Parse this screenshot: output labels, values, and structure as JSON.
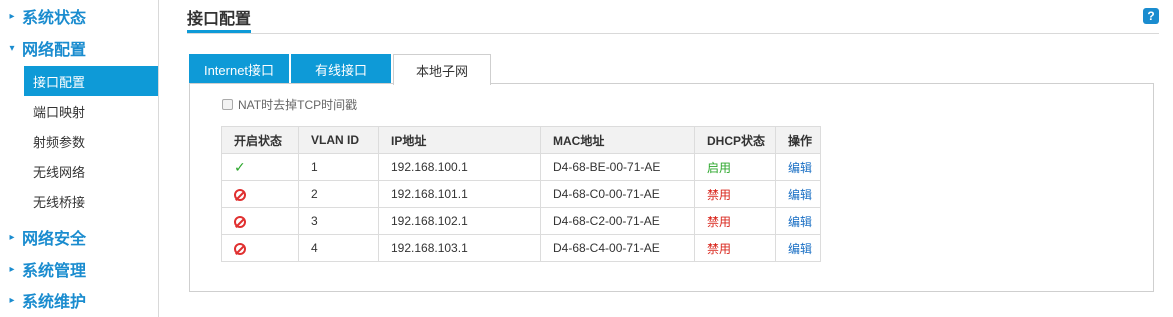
{
  "sidebar": {
    "groups": [
      {
        "label": "系统状态",
        "arrow": "▸"
      },
      {
        "label": "网络配置",
        "arrow": "▾"
      },
      {
        "label": "网络安全",
        "arrow": "▸"
      },
      {
        "label": "系统管理",
        "arrow": "▸"
      },
      {
        "label": "系统维护",
        "arrow": "▸"
      }
    ],
    "sub_items": [
      "接口配置",
      "端口映射",
      "射频参数",
      "无线网络",
      "无线桥接"
    ]
  },
  "header": {
    "title": "接口配置",
    "help": "?"
  },
  "tabs": [
    "Internet接口",
    "有线接口",
    "本地子网"
  ],
  "nat_label": "NAT时去掉TCP时间戳",
  "table": {
    "headers": [
      "开启状态",
      "VLAN ID",
      "IP地址",
      "MAC地址",
      "DHCP状态",
      "操作"
    ],
    "rows": [
      {
        "status": "on",
        "vlan": "1",
        "ip": "192.168.100.1",
        "mac": "D4-68-BE-00-71-AE",
        "dhcp": "启用",
        "action": "编辑"
      },
      {
        "status": "off",
        "vlan": "2",
        "ip": "192.168.101.1",
        "mac": "D4-68-C0-00-71-AE",
        "dhcp": "禁用",
        "action": "编辑"
      },
      {
        "status": "off",
        "vlan": "3",
        "ip": "192.168.102.1",
        "mac": "D4-68-C2-00-71-AE",
        "dhcp": "禁用",
        "action": "编辑"
      },
      {
        "status": "off",
        "vlan": "4",
        "ip": "192.168.103.1",
        "mac": "D4-68-C4-00-71-AE",
        "dhcp": "禁用",
        "action": "编辑"
      }
    ]
  },
  "colors": {
    "accent": "#0e9ad7",
    "enabled": "#2ca72c",
    "disabled": "#d9261c",
    "link": "#1a6fc4"
  }
}
